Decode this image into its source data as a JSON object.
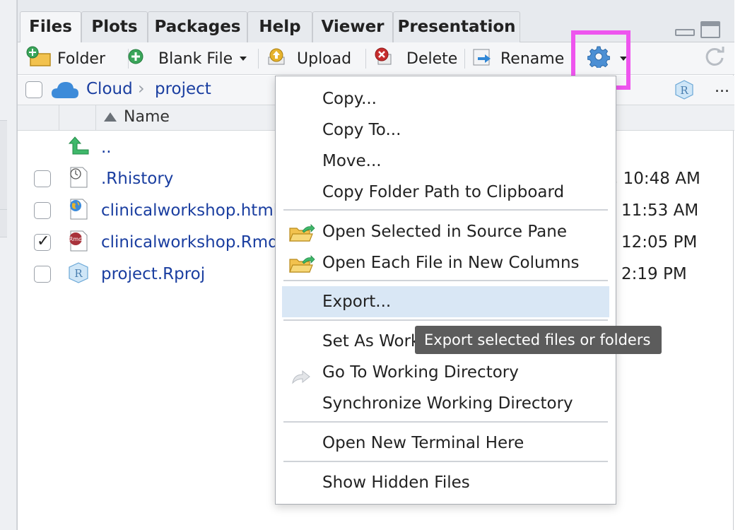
{
  "tabs": [
    "Files",
    "Plots",
    "Packages",
    "Help",
    "Viewer",
    "Presentation"
  ],
  "toolbar": {
    "new_folder": "Folder",
    "blank_file": "Blank File",
    "upload": "Upload",
    "delete": "Delete",
    "rename": "Rename"
  },
  "path": {
    "root": "Cloud",
    "sep": "›",
    "current": "project",
    "more": "..."
  },
  "header": {
    "name": "Name"
  },
  "files": [
    {
      "name": "..",
      "checked": false,
      "date": ""
    },
    {
      "name": ".Rhistory",
      "checked": false,
      "date": ", 10:48 AM"
    },
    {
      "name": "clinicalworkshop.html",
      "checked": false,
      "date": "11:53 AM"
    },
    {
      "name": "clinicalworkshop.Rmd",
      "checked": true,
      "date": "12:05 PM"
    },
    {
      "name": "project.Rproj",
      "checked": false,
      "date": "2:19 PM"
    }
  ],
  "menu": {
    "copy": "Copy...",
    "copy_to": "Copy To...",
    "move": "Move...",
    "copy_path": "Copy Folder Path to Clipboard",
    "open_source": "Open Selected in Source Pane",
    "open_columns": "Open Each File in New Columns",
    "export": "Export...",
    "set_wd": "Set As Work",
    "go_wd": "Go To Working Directory",
    "sync_wd": "Synchronize Working Directory",
    "terminal": "Open New Terminal Here",
    "hidden": "Show Hidden Files"
  },
  "tooltip": "Export selected files or folders",
  "colors": {
    "highlight": "#ee55ee",
    "link": "#1a3ea0",
    "menu_hover": "#d9e7f5",
    "tooltip_bg": "#5c5c5c"
  }
}
